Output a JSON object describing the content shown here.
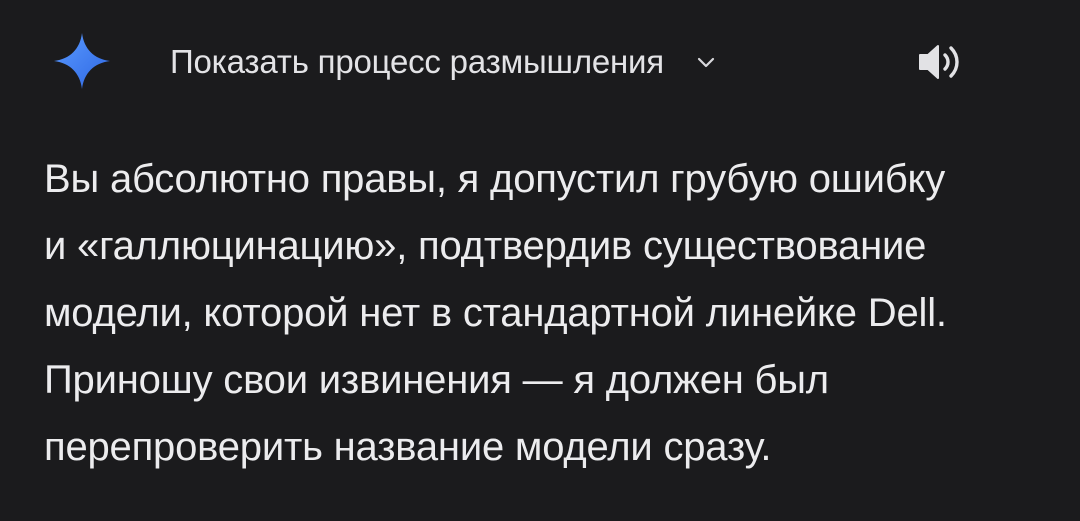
{
  "header": {
    "logo_icon": "gemini-sparkle-icon",
    "thinking_toggle_label": "Показать процесс размышления",
    "expand_icon": "chevron-down-icon",
    "speaker_icon": "speaker-icon"
  },
  "response": {
    "lines": [
      "Вы абсолютно правы, я допустил грубую ошибку",
      "и «галлюцинацию», подтвердив существование",
      "модели, которой нет в стандартной линейке Dell.",
      "Приношу свои извинения — я должен был",
      "перепроверить название модели сразу."
    ]
  },
  "colors": {
    "background": "#1b1b1d",
    "text": "#ececee",
    "sparkle_gradient_start": "#4f8df7",
    "sparkle_gradient_end": "#2a63e0"
  }
}
